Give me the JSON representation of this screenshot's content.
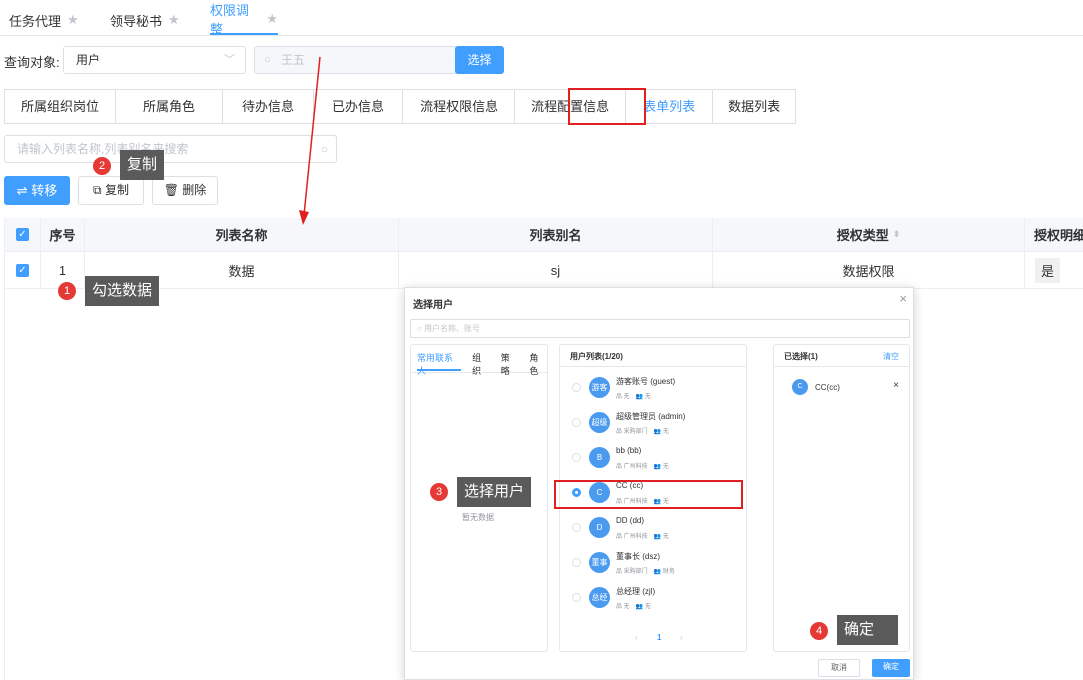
{
  "top_tabs": [
    {
      "label": "任务代理"
    },
    {
      "label": "领导秘书"
    },
    {
      "label": "权限调整"
    }
  ],
  "query": {
    "label": "查询对象:",
    "type_value": "用户",
    "search_value": "王五",
    "select_button": "选择"
  },
  "sub_tabs": [
    "所属组织岗位",
    "所属角色",
    "待办信息",
    "已办信息",
    "流程权限信息",
    "流程配置信息",
    "表单列表",
    "数据列表"
  ],
  "filter_placeholder": "请输入列表名称,列表别名来搜索",
  "actions": {
    "transfer": "转移",
    "copy": "复制",
    "delete": "删除"
  },
  "table": {
    "headers": [
      "序号",
      "列表名称",
      "列表别名",
      "授权类型",
      "授权明细"
    ],
    "rows": [
      {
        "index": "1",
        "name": "数据",
        "alias": "sj",
        "type": "数据权限",
        "detail": "是"
      }
    ]
  },
  "annotations": {
    "step1": {
      "num": "1",
      "text": "勾选数据"
    },
    "step2": {
      "num": "2",
      "text": "复制"
    },
    "step3": {
      "num": "3",
      "text": "选择用户"
    },
    "step4": {
      "num": "4",
      "text": "确定"
    }
  },
  "dialog": {
    "title": "选择用户",
    "search_placeholder": "用户名称、账号",
    "left_tabs": [
      "常用联系人",
      "组织",
      "策略",
      "角色"
    ],
    "empty_text": "暂无数据",
    "list_title": "用户列表(1/20)",
    "users": [
      {
        "avatar": "游客",
        "name": "游客账号  (guest)",
        "org": "无",
        "role": "无",
        "selected": false
      },
      {
        "avatar": "超级",
        "name": "超级管理员  (admin)",
        "org": "采购部门",
        "role": "无",
        "selected": false
      },
      {
        "avatar": "B",
        "name": "bb  (bb)",
        "org": "广州科技",
        "role": "无",
        "selected": false
      },
      {
        "avatar": "C",
        "name": "CC  (cc)",
        "org": "广州科技",
        "role": "无",
        "selected": true
      },
      {
        "avatar": "D",
        "name": "DD  (dd)",
        "org": "广州科技",
        "role": "无",
        "selected": false
      },
      {
        "avatar": "董事",
        "name": "董事长  (dsz)",
        "org": "采购部门",
        "role": "财务",
        "selected": false
      },
      {
        "avatar": "总经",
        "name": "总经理  (zjl)",
        "org": "无",
        "role": "无",
        "selected": false
      }
    ],
    "pager": {
      "prev": "‹",
      "page": "1",
      "next": "›"
    },
    "selected_title": "已选择(1)",
    "clear": "清空",
    "selected_items": [
      {
        "avatar": "C",
        "name": "CC(cc)"
      }
    ],
    "cancel": "取消",
    "confirm": "确定"
  },
  "colors": {
    "primary": "#409eff",
    "annotation_red": "#e53935",
    "highlight_border": "#e02020"
  }
}
